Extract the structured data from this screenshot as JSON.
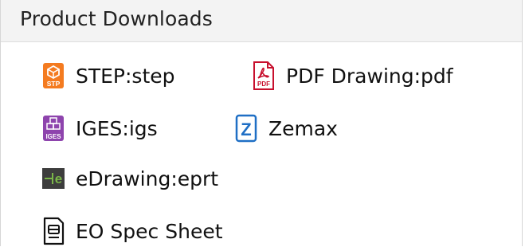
{
  "header": {
    "title": "Product Downloads"
  },
  "downloads": [
    {
      "label": "STEP:step",
      "icon": "step-file-icon",
      "color": "#f47b20"
    },
    {
      "label": "PDF Drawing:pdf",
      "icon": "pdf-file-icon",
      "color": "#c8102e"
    },
    {
      "label": "IGES:igs",
      "icon": "iges-file-icon",
      "color": "#8e44ad"
    },
    {
      "label": "Zemax",
      "icon": "zemax-icon",
      "color": "#1f6fc5"
    },
    {
      "label": "eDrawing:eprt",
      "icon": "edrawing-icon",
      "color": "#7ab648"
    },
    {
      "label": "EO Spec Sheet",
      "icon": "spec-sheet-icon",
      "color": "#111111"
    }
  ],
  "icon_text": {
    "step": "STP",
    "pdf": "PDF",
    "iges": "IGES",
    "zemax": "Z",
    "edrawing": "e"
  }
}
